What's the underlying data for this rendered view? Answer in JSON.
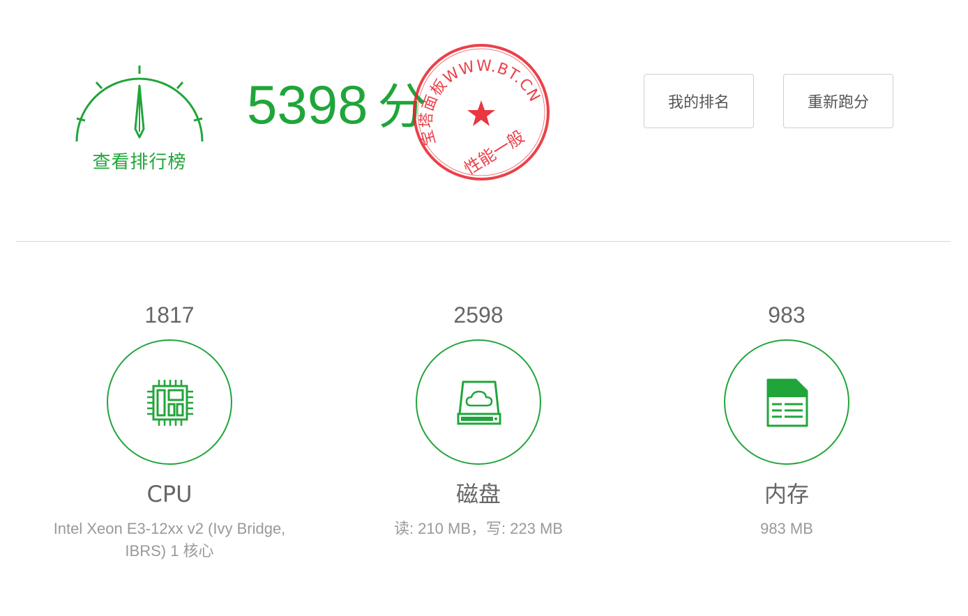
{
  "header": {
    "leaderboard_label": "查看排行榜",
    "total_score": "5398",
    "score_unit": "分",
    "stamp": {
      "url_text": "WWW.BT.CN",
      "prefix_text": "宝塔面板",
      "verdict": "性能一般",
      "color": "#e8202a"
    },
    "buttons": {
      "my_rank": "我的排名",
      "rerun": "重新跑分"
    }
  },
  "accent_color": "#20a53a",
  "metrics": [
    {
      "key": "cpu",
      "score": "1817",
      "icon": "cpu-chip-icon",
      "name": "CPU",
      "detail": "Intel Xeon E3-12xx v2 (Ivy Bridge, IBRS) 1 核心"
    },
    {
      "key": "disk",
      "score": "2598",
      "icon": "disk-cloud-icon",
      "name": "磁盘",
      "detail": "读: 210 MB，写: 223 MB"
    },
    {
      "key": "memory",
      "score": "983",
      "icon": "memory-card-icon",
      "name": "内存",
      "detail": "983 MB"
    }
  ]
}
